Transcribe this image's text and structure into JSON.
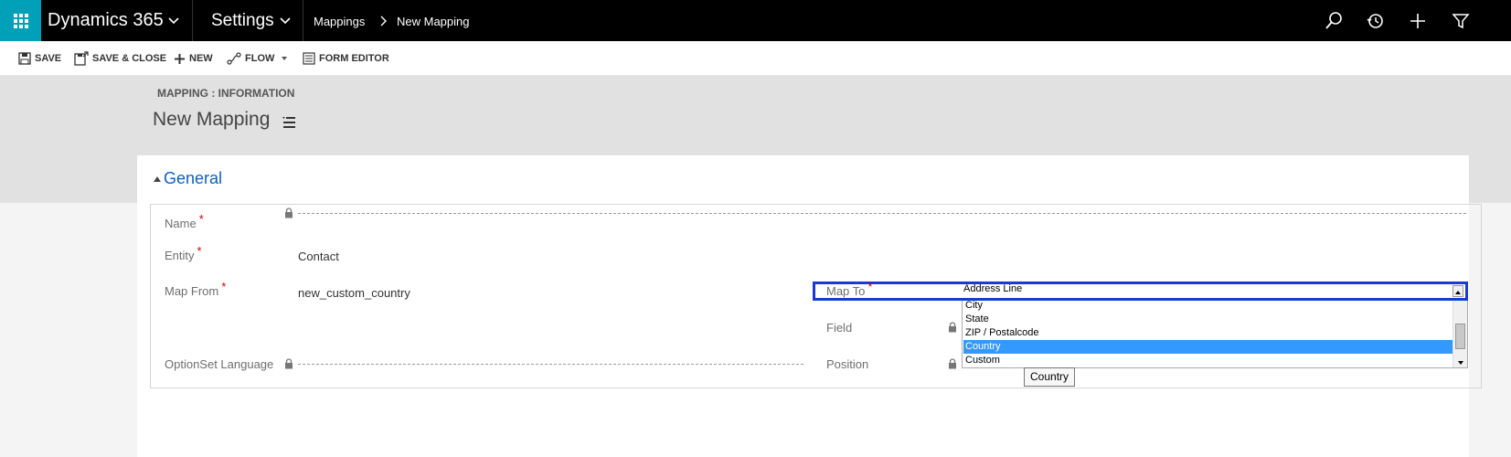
{
  "topbar": {
    "app_name": "Dynamics 365",
    "area": "Settings",
    "breadcrumb": [
      "Mappings",
      "New Mapping"
    ],
    "accent_color": "#00a1b8"
  },
  "command_bar": {
    "save": "SAVE",
    "save_close": "SAVE & CLOSE",
    "new": "NEW",
    "flow": "FLOW",
    "form_editor": "FORM EDITOR"
  },
  "header": {
    "entity_label": "MAPPING : INFORMATION",
    "record_title": "New Mapping"
  },
  "section": {
    "title": "General"
  },
  "fields": {
    "name": {
      "label": "Name",
      "value": ""
    },
    "entity": {
      "label": "Entity",
      "value": "Contact"
    },
    "map_from": {
      "label": "Map From",
      "value": "new_custom_country"
    },
    "optionset_language": {
      "label": "OptionSet Language",
      "value": ""
    },
    "map_to": {
      "label": "Map To",
      "selected": "Address Line",
      "options": [
        "City",
        "State",
        "ZIP / Postalcode",
        "Country",
        "Custom"
      ],
      "highlighted": "Country",
      "tooltip": "Country"
    },
    "field": {
      "label": "Field",
      "value": ""
    },
    "position": {
      "label": "Position",
      "value": ""
    }
  },
  "required_marker": "*"
}
